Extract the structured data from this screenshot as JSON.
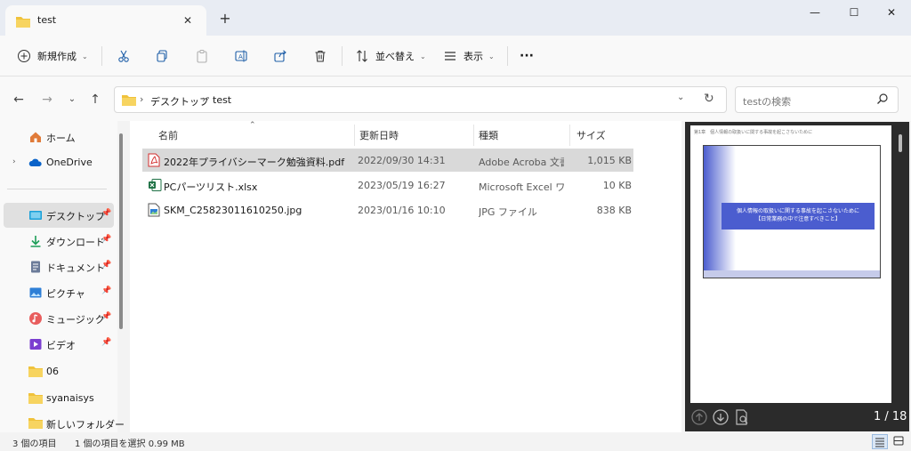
{
  "window": {
    "tab_title": "test",
    "new_tab": "+",
    "tab_close": "✕",
    "minimize": "—",
    "maximize": "☐",
    "close": "✕"
  },
  "toolbar": {
    "new_label": "新規作成",
    "sort_label": "並べ替え",
    "view_label": "表示",
    "more_label": "···"
  },
  "address": {
    "crumbs": [
      "デスクトップ",
      "test"
    ],
    "separator": "›"
  },
  "search": {
    "placeholder": "testの検索"
  },
  "sidebar": {
    "items": [
      {
        "label": "ホーム",
        "icon": "home-icon"
      },
      {
        "label": "OneDrive",
        "icon": "cloud-icon"
      },
      {
        "label": "デスクトップ",
        "icon": "desktop-icon"
      },
      {
        "label": "ダウンロード",
        "icon": "download-icon"
      },
      {
        "label": "ドキュメント",
        "icon": "document-icon"
      },
      {
        "label": "ピクチャ",
        "icon": "picture-icon"
      },
      {
        "label": "ミュージック",
        "icon": "music-icon"
      },
      {
        "label": "ビデオ",
        "icon": "video-icon"
      },
      {
        "label": "06",
        "icon": "folder-icon"
      },
      {
        "label": "syanaisys",
        "icon": "folder-icon"
      },
      {
        "label": "新しいフォルダー",
        "icon": "folder-icon"
      }
    ]
  },
  "columns": {
    "name": "名前",
    "date": "更新日時",
    "type": "種類",
    "size": "サイズ"
  },
  "files": [
    {
      "name": "2022年プライバシーマーク勉強資料.pdf",
      "date": "2022/09/30 14:31",
      "type": "Adobe Acroba 文書",
      "size": "1,015 KB",
      "icon": "pdf-icon"
    },
    {
      "name": "PCパーツリスト.xlsx",
      "date": "2023/05/19 16:27",
      "type": "Microsoft Excel ワ...",
      "size": "10 KB",
      "icon": "excel-icon"
    },
    {
      "name": "SKM_C25823011610250.jpg",
      "date": "2023/01/16 10:10",
      "type": "JPG ファイル",
      "size": "838 KB",
      "icon": "jpg-icon"
    }
  ],
  "preview": {
    "page_header": "第1章　個人情報の取扱いに関する事故を起こさないために",
    "banner_line1": "個人情報の取扱いに関する事故を起こさないために",
    "banner_line2": "【日常業務の中で注意すべきこと】",
    "page_count": "1 / 18"
  },
  "status": {
    "item_count": "3 個の項目",
    "selection": "1 個の項目を選択  0.99 MB"
  },
  "colors": {
    "accent": "#0067c0",
    "folder": "#f0c23b",
    "pdf": "#d32f2f",
    "excel": "#1e7145",
    "slide_blue": "#4b5dcf"
  }
}
